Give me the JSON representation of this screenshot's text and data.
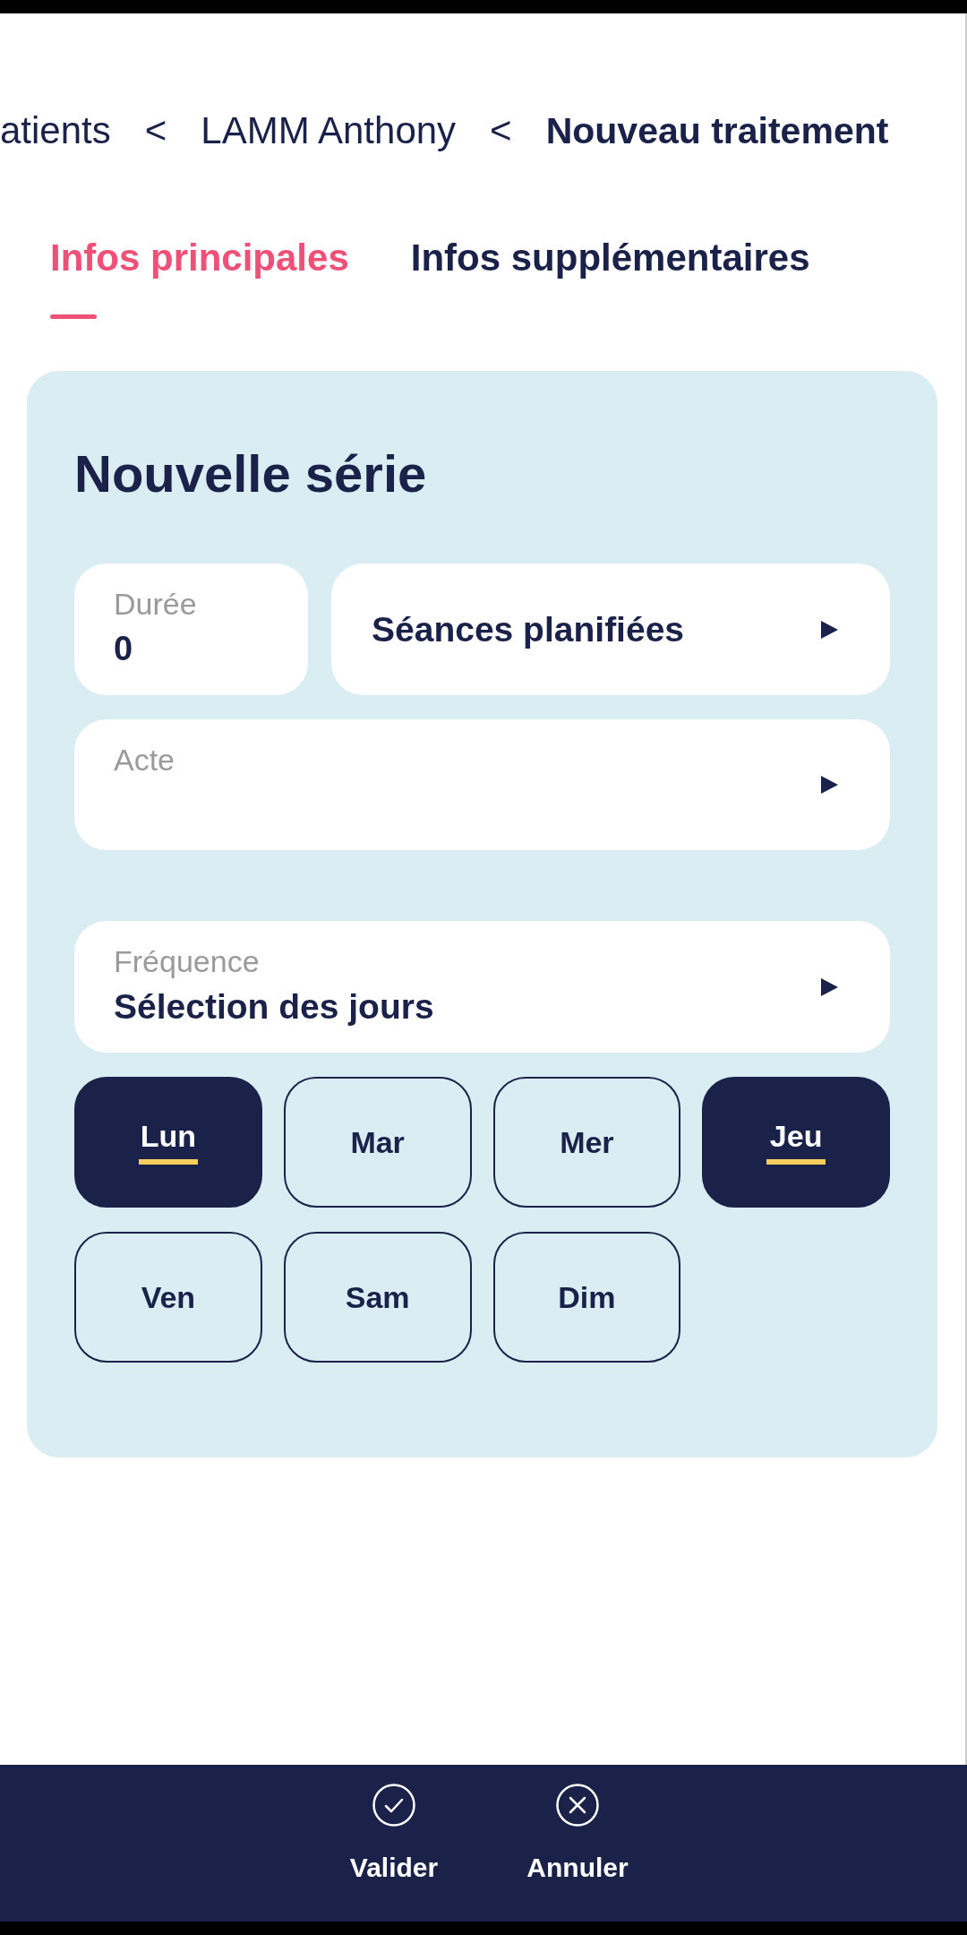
{
  "breadcrumb": [
    {
      "kind": "link",
      "text": "atients"
    },
    {
      "kind": "separator",
      "text": "<"
    },
    {
      "kind": "link",
      "text": "LAMM Anthony"
    },
    {
      "kind": "separator",
      "text": "<"
    },
    {
      "kind": "current",
      "text": "Nouveau traitement"
    }
  ],
  "tabs": [
    {
      "label": "Infos principales",
      "selected": true
    },
    {
      "label": "Infos supplémentaires",
      "selected": false
    }
  ],
  "series_card": {
    "title": "Nouvelle série",
    "duration_field": {
      "label": "Durée",
      "value": "0"
    },
    "sessions_button": {
      "label": "Séances planifiées"
    },
    "act_select": {
      "label": "Acte"
    },
    "frequency_select": {
      "label": "Fréquence",
      "value": "Sélection des jours"
    },
    "days": [
      {
        "label": "Lun",
        "selected": true
      },
      {
        "label": "Mar",
        "selected": false
      },
      {
        "label": "Mer",
        "selected": false
      },
      {
        "label": "Jeu",
        "selected": true
      },
      {
        "label": "Ven",
        "selected": false
      },
      {
        "label": "Sam",
        "selected": false
      },
      {
        "label": "Dim",
        "selected": false
      }
    ]
  },
  "actions": [
    {
      "kind": "confirm",
      "label": "Valider"
    },
    {
      "kind": "cancel",
      "label": "Annuler"
    }
  ]
}
